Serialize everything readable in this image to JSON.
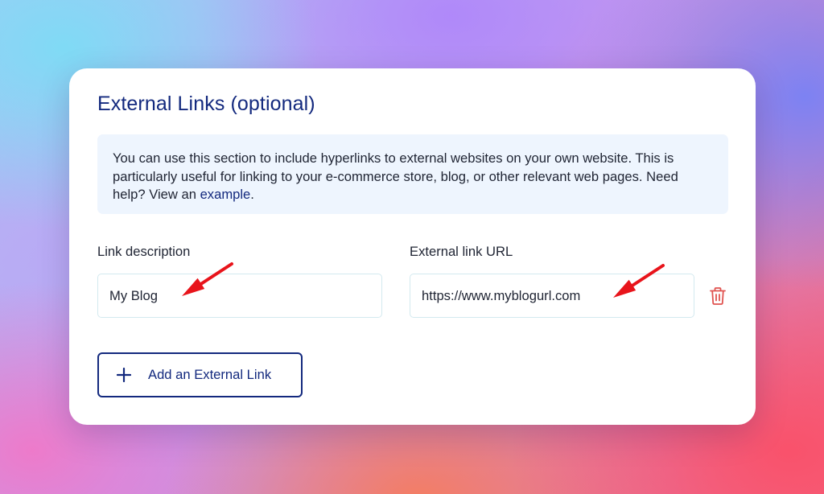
{
  "section": {
    "title": "External Links (optional)"
  },
  "info": {
    "text": "You can use this section to include hyperlinks to external websites on your own website. This is particularly useful for linking to your e-commerce store, blog, or other relevant web pages. Need help? View an ",
    "link_label": "example",
    "trailing": "."
  },
  "form": {
    "description_label": "Link description",
    "description_value": "My Blog",
    "url_label": "External link URL",
    "url_value": "https://www.myblogurl.com"
  },
  "actions": {
    "add_link_label": "Add an External Link"
  },
  "icons": {
    "delete": "trash-icon",
    "add": "plus-icon",
    "annotation": "red-arrow-icon"
  },
  "colors": {
    "heading": "#13297e",
    "info_background": "#eef5fe",
    "delete_icon": "#e0524f",
    "annotation_arrow": "#e8141b"
  }
}
